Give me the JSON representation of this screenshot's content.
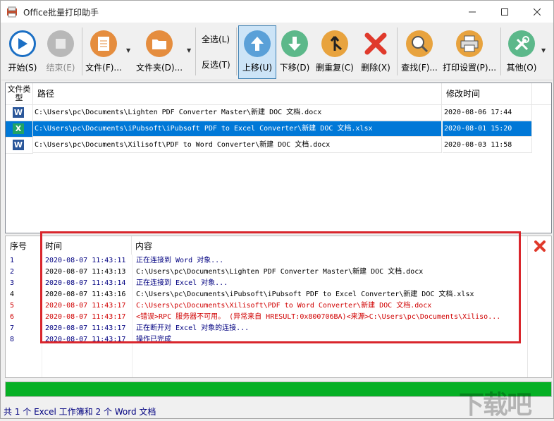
{
  "window": {
    "title": "Office批量打印助手"
  },
  "toolbar": {
    "start": "开始(S)",
    "stop": "结束(E)",
    "file": "文件(F)...",
    "folder": "文件夹(D)...",
    "select_all": "全选(L)",
    "invert": "反选(T)",
    "up": "上移(U)",
    "down": "下移(D)",
    "dedupe": "删重复(C)",
    "delete": "删除(X)",
    "find": "查找(F)...",
    "print_settings": "打印设置(P)...",
    "other": "其他(O)"
  },
  "files": {
    "headers": {
      "type": "文件类型",
      "path": "路径",
      "mtime": "修改时间"
    },
    "rows": [
      {
        "icon": "W",
        "kind": "word",
        "path": "C:\\Users\\pc\\Documents\\Lighten PDF Converter Master\\新建 DOC 文档.docx",
        "mtime": "2020-08-06 17:44"
      },
      {
        "icon": "X",
        "kind": "excel",
        "path": "C:\\Users\\pc\\Documents\\iPubsoft\\iPubsoft PDF to Excel Converter\\新建 DOC 文档.xlsx",
        "mtime": "2020-08-01 15:20"
      },
      {
        "icon": "W",
        "kind": "word",
        "path": "C:\\Users\\pc\\Documents\\Xilisoft\\PDF to Word Converter\\新建 DOC 文档.docx",
        "mtime": "2020-08-03 11:58"
      }
    ]
  },
  "log": {
    "headers": {
      "no": "序号",
      "time": "时间",
      "content": "内容"
    },
    "rows": [
      {
        "no": "1",
        "time": "2020-08-07 11:43:11",
        "content": "正在连接到 Word 对象...",
        "color": "#000080"
      },
      {
        "no": "2",
        "time": "2020-08-07 11:43:13",
        "content": "C:\\Users\\pc\\Documents\\Lighten PDF Converter Master\\新建 DOC 文档.docx",
        "color": "#000000"
      },
      {
        "no": "3",
        "time": "2020-08-07 11:43:14",
        "content": "正在连接到 Excel 对象...",
        "color": "#000080"
      },
      {
        "no": "4",
        "time": "2020-08-07 11:43:16",
        "content": "C:\\Users\\pc\\Documents\\iPubsoft\\iPubsoft PDF to Excel Converter\\新建 DOC 文档.xlsx",
        "color": "#000000"
      },
      {
        "no": "5",
        "time": "2020-08-07 11:43:17",
        "content": "C:\\Users\\pc\\Documents\\Xilisoft\\PDF to Word Converter\\新建 DOC 文档.docx",
        "color": "#d00000"
      },
      {
        "no": "6",
        "time": "2020-08-07 11:43:17",
        "content": "<错误>RPC 服务器不可用。 (异常来自 HRESULT:0x800706BA)<来源>C:\\Users\\pc\\Documents\\Xiliso...",
        "color": "#d00000"
      },
      {
        "no": "7",
        "time": "2020-08-07 11:43:17",
        "content": "正在断开对 Excel 对象的连接...",
        "color": "#000080"
      },
      {
        "no": "8",
        "time": "2020-08-07 11:43:17",
        "content": "操作已完成",
        "color": "#000080"
      }
    ]
  },
  "progress": {
    "value": 1.0
  },
  "status": "共 1 个 Excel 工作簿和 2 个 Word 文档",
  "watermark": "下载吧"
}
